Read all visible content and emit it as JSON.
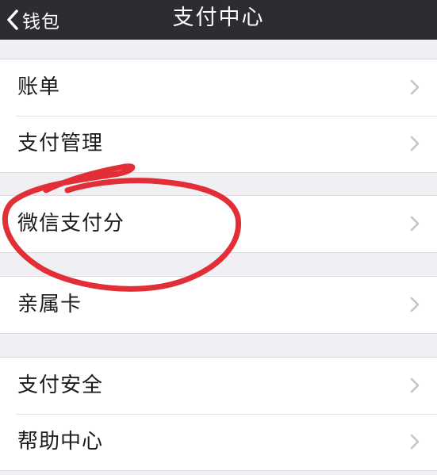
{
  "nav": {
    "back_label": "钱包",
    "title": "支付中心"
  },
  "groups": [
    {
      "items": [
        {
          "label": "账单"
        },
        {
          "label": "支付管理"
        }
      ]
    },
    {
      "items": [
        {
          "label": "微信支付分"
        }
      ]
    },
    {
      "items": [
        {
          "label": "亲属卡"
        }
      ]
    },
    {
      "items": [
        {
          "label": "支付安全"
        },
        {
          "label": "帮助中心"
        }
      ]
    }
  ],
  "colors": {
    "navbar_bg": "#2d2d31",
    "page_bg": "#efeff4",
    "annotation_red": "#e0242c",
    "chevron": "#c4c4c8"
  },
  "icons": {
    "back": "chevron-left-icon",
    "disclosure": "chevron-right-icon"
  }
}
